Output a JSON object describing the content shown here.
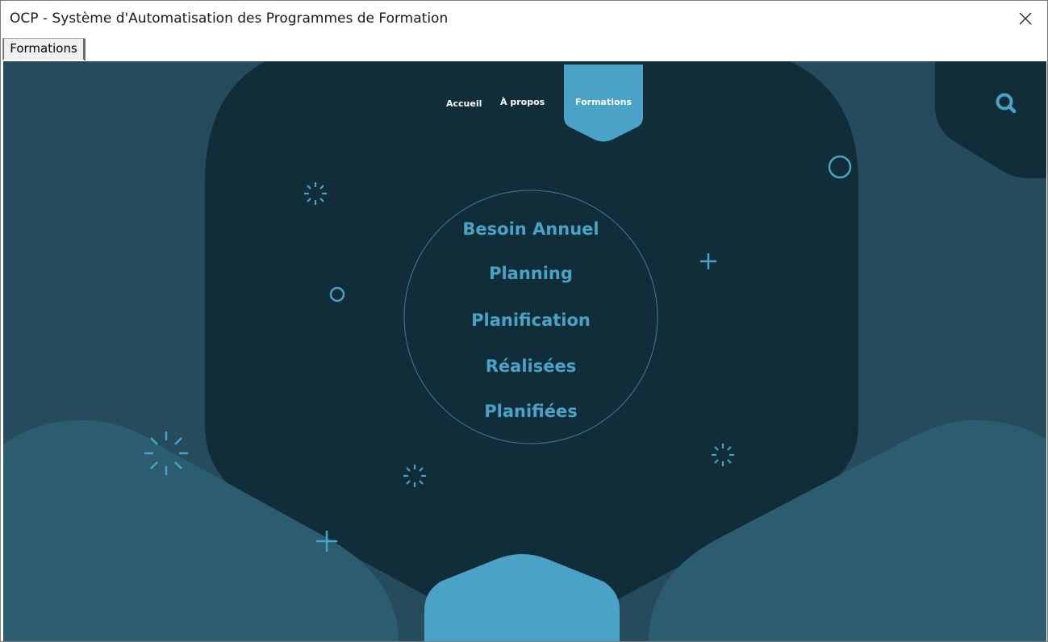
{
  "window": {
    "title": "OCP - Système d'Automatisation des Programmes de Formation"
  },
  "tabs": [
    {
      "label": "Formations",
      "selected": true
    }
  ],
  "nav": {
    "home_label": "Accueil",
    "about_label": "À propos",
    "formations_label": "Formations",
    "active": "Formations"
  },
  "menu": {
    "items": [
      {
        "label": "Besoin Annuel"
      },
      {
        "label": "Planning"
      },
      {
        "label": "Planification"
      },
      {
        "label": "Réalisées"
      },
      {
        "label": "Planifiées"
      }
    ]
  },
  "icons": {
    "close": "close-icon",
    "search": "search-icon",
    "decorations": [
      "sparkle-icon",
      "plus-icon",
      "circle-icon"
    ]
  },
  "colors": {
    "background": "#264b5d",
    "panel": "#122d3a",
    "wave": "#2b5c70",
    "accent": "#4aa3c7",
    "text_light": "#ffffff"
  }
}
